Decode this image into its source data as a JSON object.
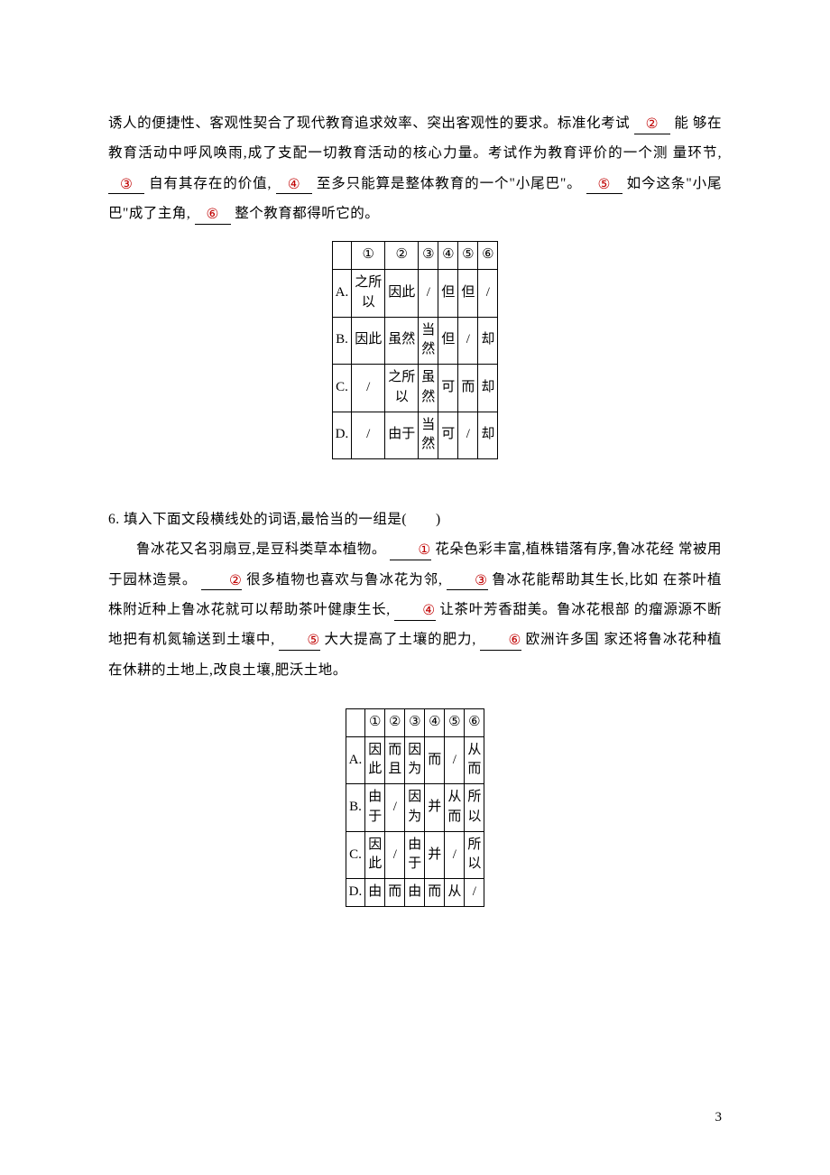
{
  "passage1": {
    "line1_prefix": "诱人的便捷性、客观性契合了现代教育追求效率、突出客观性的要求。标准化考试",
    "b2": "②",
    "line1_suffix": "能",
    "line2_a": "够在教育活动中呼风唤雨,成了支配一切教育活动的核心力量。考试作为教育评价的一个测",
    "line3_a": "量环节,",
    "b3": "③",
    "line3_b": "自有其存在的价值,",
    "b4": "④",
    "line3_c": "至多只能算是整体教育的一个\"小尾巴\"。",
    "b5": "⑤",
    "line4_a": "如今这条\"小尾巴\"成了主角,",
    "b6": "⑥",
    "line4_b": "整个教育都得听它的。"
  },
  "table1": {
    "headers": [
      "",
      "①",
      "②",
      "③",
      "④",
      "⑤",
      "⑥"
    ],
    "rows": [
      {
        "label": "A.",
        "cells": [
          "之所以",
          "因此",
          "/",
          "但",
          "但",
          "/"
        ]
      },
      {
        "label": "B.",
        "cells": [
          "因此",
          "虽然",
          "当然",
          "但",
          "/",
          "却"
        ]
      },
      {
        "label": "C.",
        "cells": [
          "/",
          "之所以",
          "虽然",
          "可",
          "而",
          "却"
        ]
      },
      {
        "label": "D.",
        "cells": [
          "/",
          "由于",
          "当然",
          "可",
          "/",
          "却"
        ]
      }
    ]
  },
  "q6": {
    "stem": "6. 填入下面文段横线处的词语,最恰当的一组是(　　)"
  },
  "passage2": {
    "l1a": "鲁冰花又名羽扇豆,是豆科类草本植物。",
    "b1": "①",
    "l1b": "花朵色彩丰富,植株错落有序,鲁冰花经",
    "l2a": "常被用于园林造景。",
    "b2": "②",
    "l2b": "很多植物也喜欢与鲁冰花为邻,",
    "b3": "③",
    "l2c": "鲁冰花能帮助其生长,比如",
    "l3a": "在茶叶植株附近种上鲁冰花就可以帮助茶叶健康生长,",
    "b4": "④",
    "l3b": "让茶叶芳香甜美。鲁冰花根部",
    "l4a": "的瘤源源不断地把有机氮输送到土壤中,",
    "b5": "⑤",
    "l4b": "大大提高了土壤的肥力,",
    "b6": "⑥",
    "l4c": "欧洲许多国",
    "l5a": "家还将鲁冰花种植在休耕的土地上,改良土壤,肥沃土地。"
  },
  "table2": {
    "headers": [
      "",
      "①",
      "②",
      "③",
      "④",
      "⑤",
      "⑥"
    ],
    "rows": [
      {
        "label": "A.",
        "cells": [
          "因此",
          "而且",
          "因为",
          "而",
          "/",
          "从而"
        ]
      },
      {
        "label": "B.",
        "cells": [
          "由于",
          "/",
          "因为",
          "并",
          "从而",
          "所以"
        ]
      },
      {
        "label": "C.",
        "cells": [
          "因此",
          "/",
          "由于",
          "并",
          "/",
          "所以"
        ]
      },
      {
        "label": "D.",
        "cells": [
          "由",
          "而",
          "由",
          "而",
          "从",
          "/"
        ]
      }
    ]
  },
  "page_number": "3"
}
